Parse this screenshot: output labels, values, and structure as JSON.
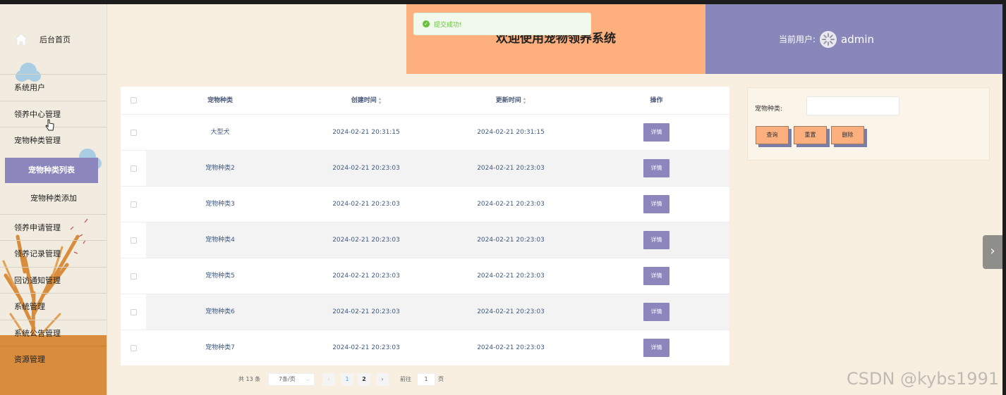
{
  "sidebar": {
    "home_label": "后台首页",
    "items": [
      {
        "label": "系统用户"
      },
      {
        "label": "领养中心管理"
      },
      {
        "label": "宠物种类管理"
      },
      {
        "label": "领养申请管理"
      },
      {
        "label": "领养记录管理"
      },
      {
        "label": "回访通知管理"
      },
      {
        "label": "系统管理"
      },
      {
        "label": "系统公告管理"
      },
      {
        "label": "资源管理"
      }
    ],
    "sub_items": [
      {
        "label": "宠物种类列表",
        "active": true
      },
      {
        "label": "宠物种类添加",
        "active": false
      }
    ]
  },
  "header": {
    "title": "欢迎使用宠物领养系统",
    "user_label": "当前用户:",
    "user_name": "admin"
  },
  "toast": {
    "message": "提交成功!"
  },
  "table": {
    "columns": [
      "宠物种类",
      "创建时间",
      "更新时间",
      "操作"
    ],
    "detail_label": "详情",
    "rows": [
      {
        "kind": "大型犬",
        "created": "2024-02-21 20:31:15",
        "updated": "2024-02-21 20:31:15"
      },
      {
        "kind": "宠物种类2",
        "created": "2024-02-21 20:23:03",
        "updated": "2024-02-21 20:23:03"
      },
      {
        "kind": "宠物种类3",
        "created": "2024-02-21 20:23:03",
        "updated": "2024-02-21 20:23:03"
      },
      {
        "kind": "宠物种类4",
        "created": "2024-02-21 20:23:03",
        "updated": "2024-02-21 20:23:03"
      },
      {
        "kind": "宠物种类5",
        "created": "2024-02-21 20:23:03",
        "updated": "2024-02-21 20:23:03"
      },
      {
        "kind": "宠物种类6",
        "created": "2024-02-21 20:23:03",
        "updated": "2024-02-21 20:23:03"
      },
      {
        "kind": "宠物种类7",
        "created": "2024-02-21 20:23:03",
        "updated": "2024-02-21 20:23:03"
      }
    ]
  },
  "pagination": {
    "total": "共 13 条",
    "page_size": "7条/页",
    "pages": [
      "1",
      "2"
    ],
    "current_page": "1",
    "goto_label": "前往",
    "goto_value": "1",
    "page_unit": "页"
  },
  "search": {
    "label": "宠物种类:",
    "query_label": "查询",
    "reset_label": "重置",
    "delete_label": "删除"
  },
  "watermark": "CSDN @kybs1991",
  "colors": {
    "accent_purple": "#8b86bb",
    "header_orange": "#fdaf7d",
    "header_purple": "#8987ba",
    "sidebar_bottom": "#d98c3b",
    "success": "#67c23a"
  }
}
